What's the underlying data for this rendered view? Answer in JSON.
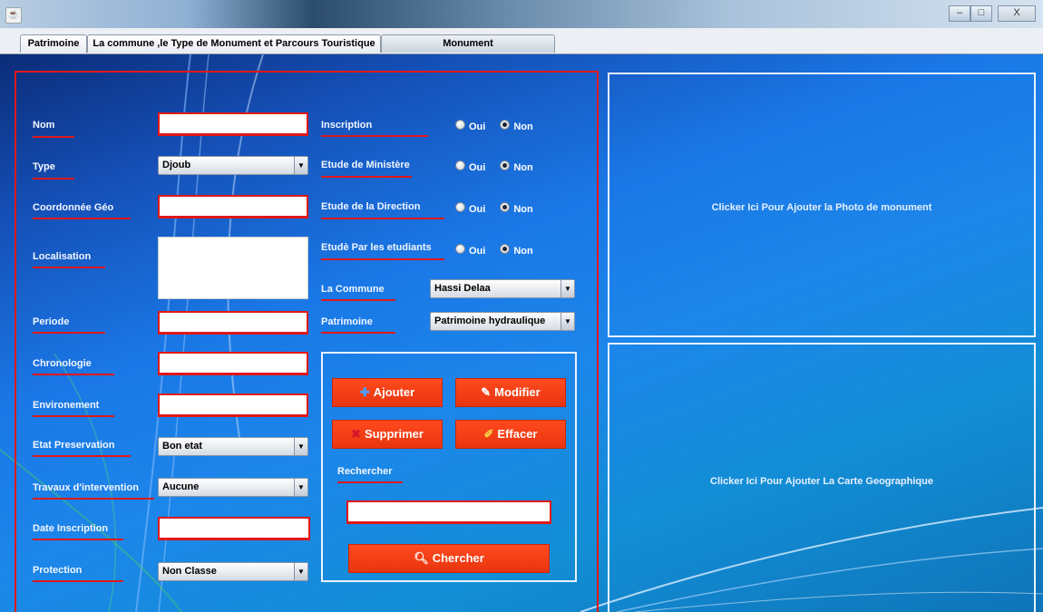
{
  "window": {
    "minimize_symbol": "–",
    "maximize_symbol": "□",
    "close_symbol": "X"
  },
  "tabs": [
    {
      "label": "Patrimoine"
    },
    {
      "label": "La commune ,le  Type de Monument et Parcours Touristique"
    },
    {
      "label": "Monument"
    }
  ],
  "form": {
    "nom": {
      "label": "Nom",
      "value": ""
    },
    "type": {
      "label": "Type",
      "selected": "Djoub"
    },
    "coordonnee": {
      "label": "Coordonnée Géo",
      "value": ""
    },
    "localisation": {
      "label": "Localisation",
      "value": ""
    },
    "periode": {
      "label": "Periode",
      "value": ""
    },
    "chronologie": {
      "label": "Chronologie",
      "value": ""
    },
    "environement": {
      "label": "Environement",
      "value": ""
    },
    "etat": {
      "label": "Etat Preservation",
      "selected": "Bon etat"
    },
    "travaux": {
      "label": "Travaux d'intervention",
      "selected": "Aucune"
    },
    "date_inscription": {
      "label": "Date Inscription",
      "value": ""
    },
    "protection": {
      "label": "Protection",
      "selected": "Non Classe"
    }
  },
  "radios": {
    "oui": "Oui",
    "non": "Non",
    "rows": [
      {
        "label": "Inscription",
        "selected": "Non"
      },
      {
        "label": "Etude de Ministère",
        "selected": "Non"
      },
      {
        "label": "Etude de la Direction",
        "selected": "Non"
      },
      {
        "label": "Etudè Par les etudiants",
        "selected": "Non"
      }
    ]
  },
  "commune": {
    "label": "La Commune",
    "selected": "Hassi Delaa"
  },
  "patrimoine": {
    "label": "Patrimoine",
    "selected": "Patrimoine hydraulique"
  },
  "actions": {
    "ajouter": "Ajouter",
    "modifier": "Modifier",
    "supprimer": "Supprimer",
    "effacer": "Effacer",
    "rechercher_label": "Rechercher",
    "search_value": "",
    "chercher": "Chercher"
  },
  "panels": {
    "photo": "Clicker Ici Pour Ajouter la Photo de monument",
    "carte": "Clicker Ici Pour Ajouter La Carte Geographique"
  },
  "colors": {
    "accent_red": "#e01818",
    "button_orange": "#ff4a1e",
    "background_blue": "#1a78e6"
  }
}
